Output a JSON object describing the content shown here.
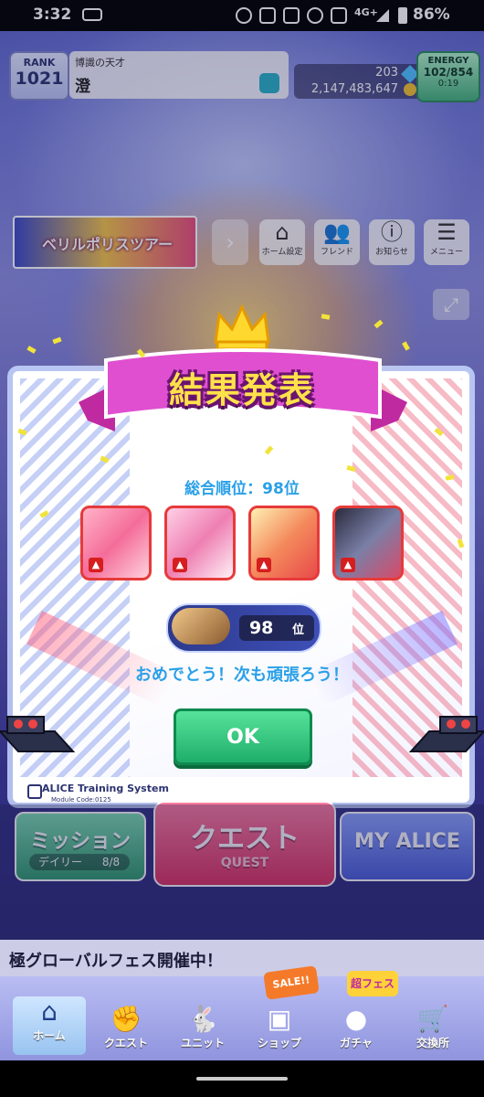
{
  "status_bar": {
    "time": "3:32",
    "network": "4G+",
    "battery": "86%"
  },
  "header": {
    "rank_label": "RANK",
    "rank_value": "1021",
    "player_title": "博識の天才",
    "player_name": "澄",
    "gems": "203",
    "coins": "2,147,483,647",
    "energy_label": "ENERGY",
    "energy_value": "102/854",
    "energy_timer": "0:19"
  },
  "banner": {
    "text": "ベリルポリスツアー"
  },
  "menu": {
    "items": [
      {
        "label": "ホーム設定",
        "icon": "home-settings-icon"
      },
      {
        "label": "フレンド",
        "icon": "friends-icon"
      },
      {
        "label": "お知らせ",
        "icon": "info-icon"
      },
      {
        "label": "メニュー",
        "icon": "menu-list-icon"
      }
    ]
  },
  "dialog": {
    "title": "結果発表",
    "overall_rank": "総合順位：98位",
    "rank_number": "98",
    "rank_suffix": "位",
    "message": "おめでとう！次も頑張ろう！",
    "ok_label": "OK",
    "system_label": "ALICE Training System",
    "module_code": "Module Code:0125"
  },
  "big_buttons": {
    "mission_label": "ミッション",
    "mission_sub": "デイリー",
    "mission_count": "8/8",
    "quest_label": "クエスト",
    "quest_sub": "QUEST",
    "myalice_label": "MY ALICE"
  },
  "notice": {
    "text": "極グローバルフェス開催中！"
  },
  "bottom_nav": {
    "items": [
      {
        "label": "ホーム",
        "icon": "home-icon"
      },
      {
        "label": "クエスト",
        "icon": "quest-icon"
      },
      {
        "label": "ユニット",
        "icon": "unit-icon"
      },
      {
        "label": "ショップ",
        "icon": "shop-icon"
      },
      {
        "label": "ガチャ",
        "icon": "gacha-icon"
      },
      {
        "label": "交換所",
        "icon": "exchange-icon"
      }
    ],
    "badges": {
      "sale": "SALE!!",
      "fes": "超フェス"
    }
  },
  "colors": {
    "accent_blue": "#2aa0e8",
    "ok_green": "#1fae6a",
    "ribbon_magenta": "#d63bb8",
    "title_yellow": "#ffe14a"
  }
}
